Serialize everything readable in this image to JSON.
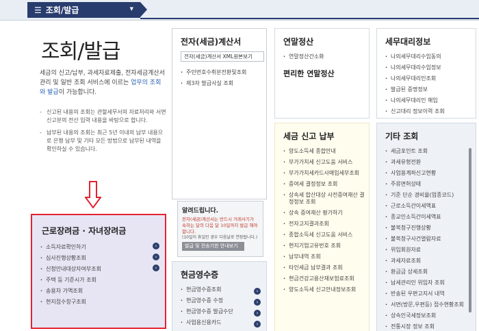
{
  "nav": {
    "menu_label": "조회/발급"
  },
  "intro": {
    "title": "조회/발급",
    "desc_a": "세금의 신고/납부, 과세자료제출, 전자세금계산서 관리 및 일반 조회 서비스에 이르는 ",
    "desc_highlight": "업무의 조회와 발급",
    "desc_b": "이 가능합니다.",
    "notes": [
      "신고된 내용의 조회는 관할세무서의 자료처리와 서면신고분의 전산 입력 내용을 바탕으로 합니다.",
      "납부된 내용의 조회는 최근 5년 이내의 납부 내용으로 은행 납부 및 기타 모든 방법으로 납부된 내역을 확인하실 수 있습니다."
    ]
  },
  "tax_invoice": {
    "title": "전자(세금)계산서",
    "tag": "전자(세금)계산서 XML원본보기",
    "items": [
      "주민번호수취분전환및조회",
      "제3자 발급사실 조회"
    ]
  },
  "notice": {
    "title": "알려드립니다.",
    "text": "전자(세금)계산서는 반드시 거래사기가 속하는 달의 다음 달 10일까지 발급 해야 합니다.",
    "sub": "(10일이 휴일인 경우 다음날로 연장됩니다.)",
    "button": "발급 및 전송기한 안내보기"
  },
  "cash_receipt": {
    "title": "현금영수증",
    "items": [
      "현금영수증조회",
      "현금영수증 수정",
      "현금영수증 발급수단",
      "사업용신용카드"
    ]
  },
  "year_end": {
    "title": "연말정산",
    "items": [
      "연말정산간소화"
    ],
    "subtitle": "편리한 연말정산"
  },
  "tax_agent": {
    "title": "세무대리정보",
    "items": [
      "나의세무대리수임동의",
      "나의세무대리수임정보",
      "나의세무대리인조회",
      "발급된 증명정보",
      "나의세무대리인 해임",
      "신고대리 정보이력 조회"
    ]
  },
  "report_pay": {
    "title": "세금 신고 납부",
    "items": [
      "양도소득세 종합안내",
      "부가가치세 신고도움 서비스",
      "부가가치세카드사매입세부조회",
      "증여세 결정정보 조회",
      "상속세 합산대상 사전증여재산 결정정보 조회",
      "상속 증여재산 평가하기",
      "전자고지결과조회",
      "종합소득세 신고도움 서비스",
      "현지기업고유번호 조회",
      "납부내역 조회",
      "타인세금 납부결과 조회",
      "현금건강고용산재보험료조회",
      "양도소득세 신고안내정보조회"
    ]
  },
  "other": {
    "title": "기타 조회",
    "items": [
      "세금포인트 조회",
      "과세유형전환",
      "사업용계좌신고현황",
      "주류면허상태",
      "기준 단순 경비율(업종코드)",
      "근로소득간이세액표",
      "종교인소득간이세액표",
      "불복청구진행상황",
      "불복청구사건열람자료",
      "위임회원자료",
      "과세자료조회",
      "환급금 상세조회",
      "납세관리인 위임자 조회",
      "반송된 우편고지서 내역",
      "서면(방문,우편등) 접수현황조회",
      "상속인국세정보조회",
      "전통시장 정보 조회"
    ]
  },
  "earned_income": {
    "title": "근로장려금 · 자녀장려금",
    "items": [
      "소득자료확인하기",
      "심사진행상황조회",
      "신청안내대상자여부조회",
      "주택 등 기준시가 조회",
      "송용차 가액조회",
      "현지접수창구조회"
    ]
  }
}
